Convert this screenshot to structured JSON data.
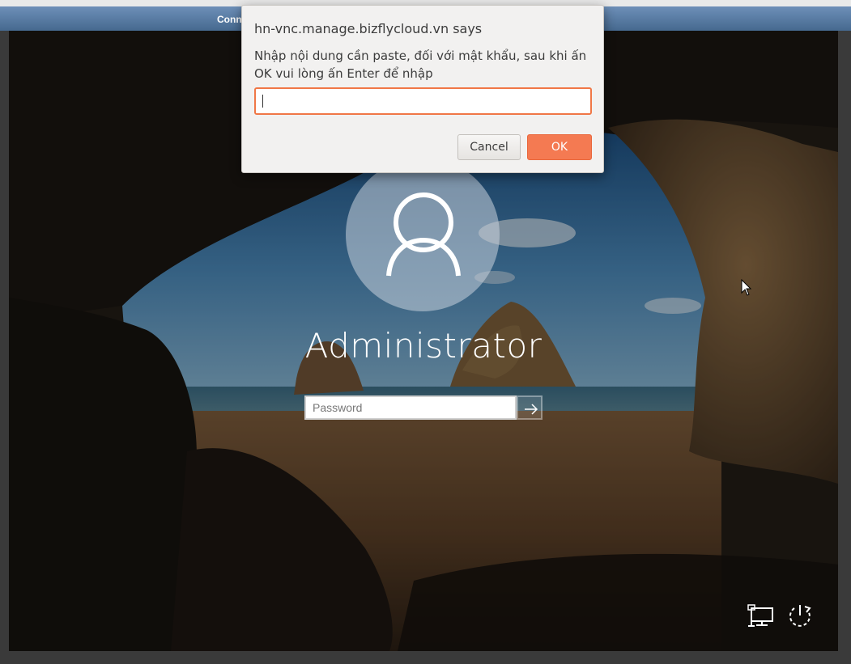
{
  "vnc": {
    "status": "Conn"
  },
  "dialog": {
    "title": "hn-vnc.manage.bizflycloud.vn says",
    "message": "Nhập nội dung cần paste, đối với mật khẩu, sau khi ấn OK vui lòng ấn Enter để nhập",
    "input_value": "",
    "cancel_label": "Cancel",
    "ok_label": "OK"
  },
  "login": {
    "username": "Administrator",
    "password_placeholder": "Password",
    "submit_icon": "arrow-right-icon"
  },
  "tray": {
    "network_icon": "network-icon",
    "power_icon": "power-icon"
  },
  "colors": {
    "accent": "#f47a52",
    "vnc_bar": "#567aa3"
  }
}
